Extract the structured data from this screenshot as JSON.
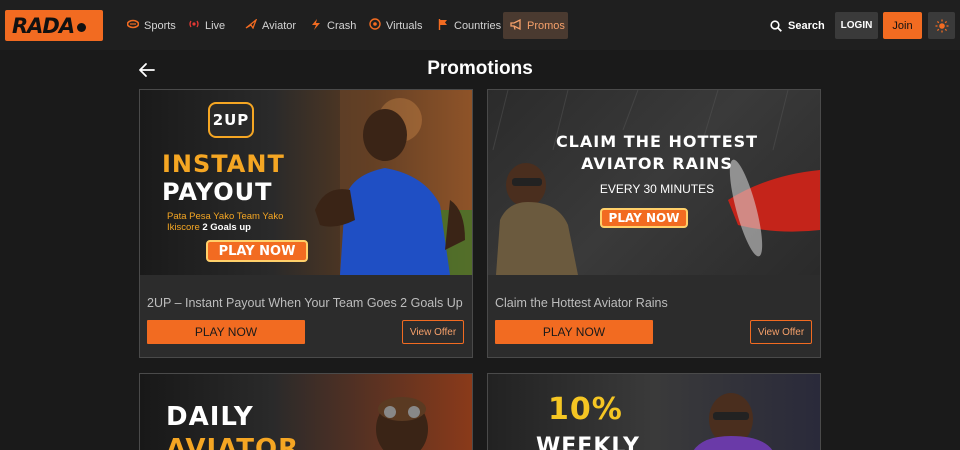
{
  "brand": {
    "logo_text": "RADA"
  },
  "nav": {
    "items": [
      {
        "label": "Sports",
        "icon": "ball-icon"
      },
      {
        "label": "Live",
        "icon": "live-icon"
      },
      {
        "label": "Aviator",
        "icon": "plane-icon"
      },
      {
        "label": "Crash",
        "icon": "bolt-icon"
      },
      {
        "label": "Virtuals",
        "icon": "virtuals-icon"
      },
      {
        "label": "Countries",
        "icon": "flag-icon"
      },
      {
        "label": "Promos",
        "icon": "megaphone-icon",
        "active": true
      }
    ],
    "search_label": "Search",
    "login_label": "LOGIN",
    "join_label": "Join"
  },
  "page": {
    "title": "Promotions"
  },
  "promos": [
    {
      "title": "2UP – Instant Payout When Your Team Goes 2 Goals Up",
      "play_label": "PLAY NOW",
      "view_label": "View Offer",
      "banner": {
        "badge": "2UP",
        "line1": "INSTANT",
        "line2": "PAYOUT",
        "sub1": "Pata Pesa Yako Team Yako",
        "sub2a": "Ikiscore ",
        "sub2b": "2 Goals up",
        "cta": "PLAY NOW"
      }
    },
    {
      "title": "Claim the Hottest Aviator Rains",
      "play_label": "PLAY NOW",
      "view_label": "View Offer",
      "banner": {
        "line1": "CLAIM THE HOTTEST",
        "line2": "AVIATOR RAINS",
        "sub": "EVERY 30 MINUTES",
        "cta": "PLAY NOW"
      }
    },
    {
      "banner": {
        "line1": "DAILY",
        "line2": "AVIATOR"
      }
    },
    {
      "banner": {
        "line1": "10%",
        "line2": "WEEKLY"
      }
    }
  ],
  "colors": {
    "accent": "#f26b21",
    "background": "#1a1a1a",
    "card": "#2c2c2c"
  }
}
